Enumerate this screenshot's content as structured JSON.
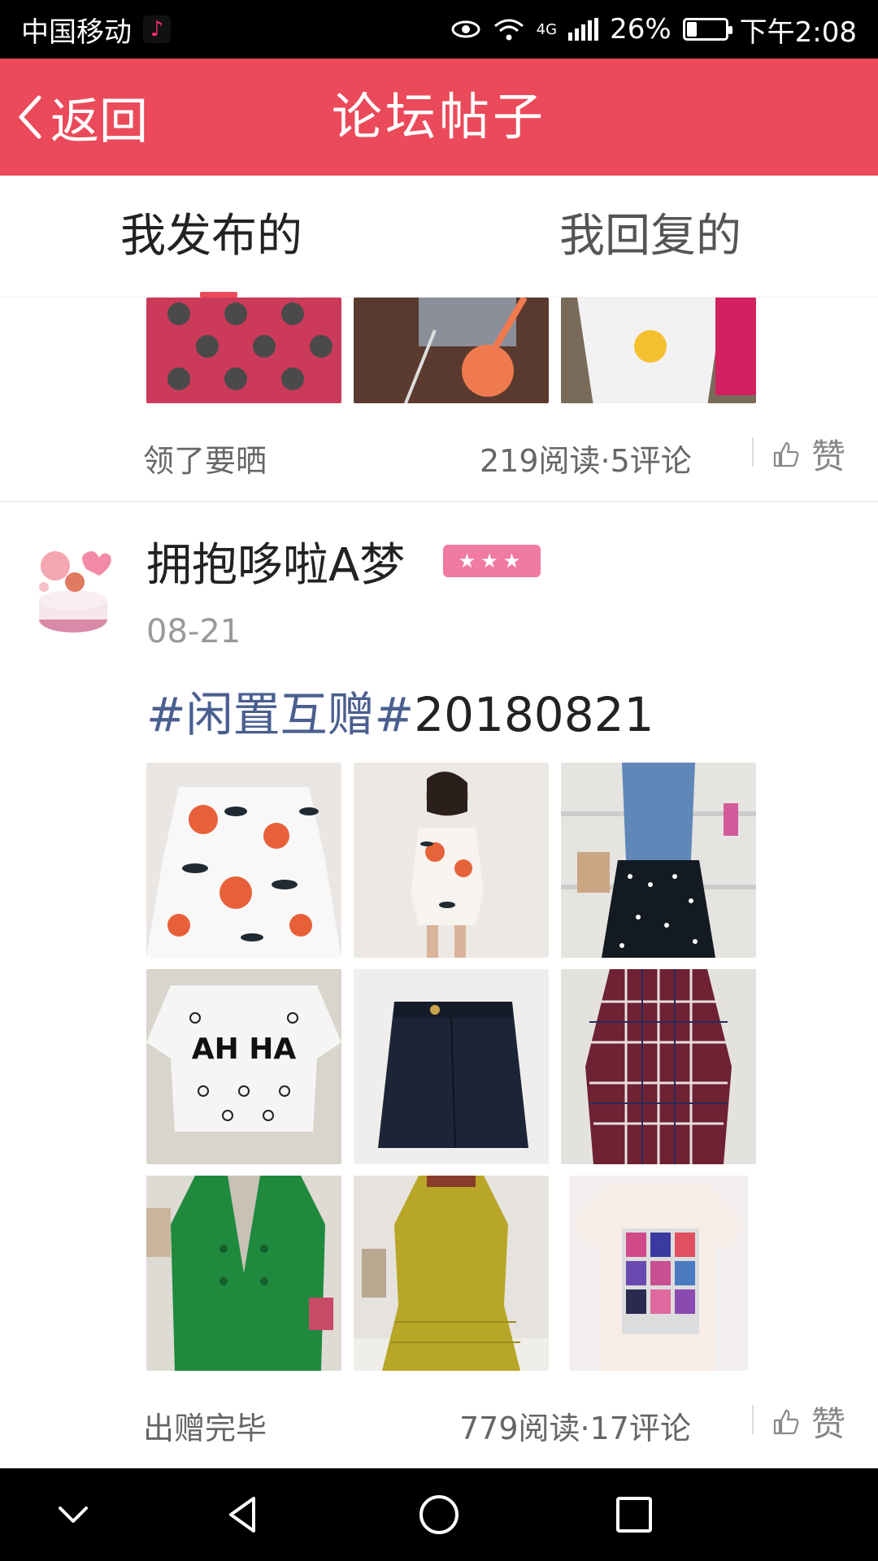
{
  "status_bar": {
    "carrier": "中国移动",
    "network": "4G",
    "battery": "26%",
    "battery_level": 0.26,
    "time": "下午2:08"
  },
  "header": {
    "back_label": "返回",
    "title": "论坛帖子"
  },
  "tabs": [
    {
      "label": "我发布的",
      "active": true
    },
    {
      "label": "我回复的",
      "active": false
    }
  ],
  "posts": [
    {
      "footer_left": "领了要晒",
      "stats": "219阅读·5评论",
      "like_label": "赞"
    },
    {
      "username": "拥抱哆啦A梦",
      "badge": "★★★",
      "date": "08-21",
      "text_tag": "#闲置互赠#",
      "text_rest": "20180821",
      "footer_left": "出赠完毕",
      "stats": "779阅读·17评论",
      "like_label": "赞"
    }
  ],
  "colors": {
    "accent": "#ea4a5a",
    "tag": "#4a5f8f",
    "badge": "#f07aa0"
  }
}
